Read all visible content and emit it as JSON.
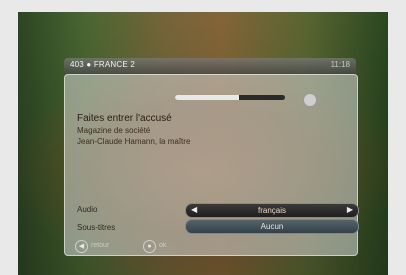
{
  "header": {
    "channel": "403 ● FRANCE 2",
    "time": "11:18"
  },
  "program": {
    "title": "Faites entrer l'accusé",
    "subtitle": "Magazine de société",
    "cast": "Jean-Claude Hamann, la maître"
  },
  "progress_fraction": 0.58,
  "icons": {
    "info": "info-icon",
    "back": "back-icon",
    "ok": "ok-icon"
  },
  "settings": {
    "audio_label": "Audio",
    "audio_value": "français",
    "subtitles_label": "Sous-titres",
    "subtitles_value": "Aucun"
  },
  "footer": {
    "back_label": "retour",
    "ok_label": "ok"
  },
  "colors": {
    "panel": "#d7d7d7",
    "selected": "#1e1e1e",
    "subtitle_sel": "#344048"
  }
}
